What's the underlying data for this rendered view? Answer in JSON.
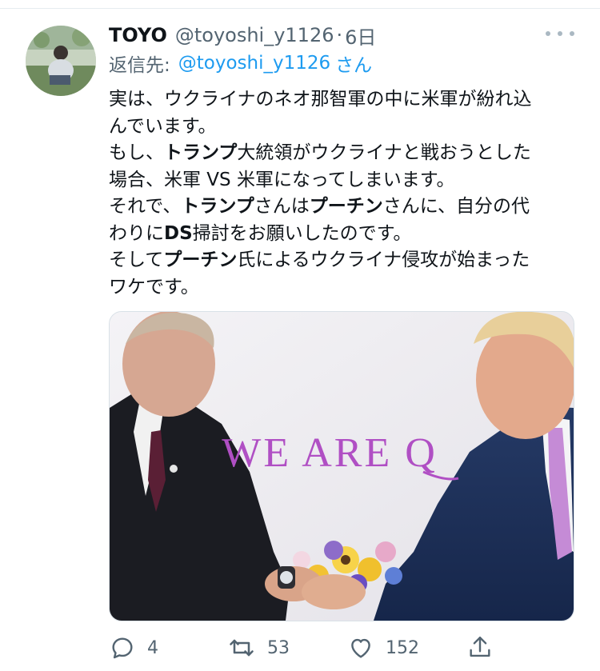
{
  "tweet": {
    "display_name": "TOYO",
    "handle": "@toyoshi_y1126",
    "separator": "·",
    "time": "6日",
    "reply_prefix": "返信先:",
    "reply_handle": "@toyoshi_y1126",
    "reply_suffix": "さん",
    "body_lines": [
      [
        {
          "t": "実は、ウクライナのネオ那智軍の中に米軍が紛れ込"
        }
      ],
      [
        {
          "t": "んでいます。"
        }
      ],
      [
        {
          "t": "もし、"
        },
        {
          "t": "トランプ",
          "b": true
        },
        {
          "t": "大統領がウクライナと戦おうとした"
        }
      ],
      [
        {
          "t": "場合、米軍 VS 米軍になってしまいます。"
        }
      ],
      [
        {
          "t": "それで、"
        },
        {
          "t": "トランプ",
          "b": true
        },
        {
          "t": "さんは"
        },
        {
          "t": "プーチン",
          "b": true
        },
        {
          "t": "さんに、自分の代"
        }
      ],
      [
        {
          "t": "わりに"
        },
        {
          "t": "DS",
          "b": true
        },
        {
          "t": "掃討をお願いしたのです。"
        }
      ],
      [
        {
          "t": "そして"
        },
        {
          "t": "プーチン",
          "b": true
        },
        {
          "t": "氏によるウクライナ侵攻が始まった"
        }
      ],
      [
        {
          "t": "ワケです。"
        }
      ]
    ],
    "image_caption": "WE ARE Q"
  },
  "actions": {
    "reply_count": "4",
    "retweet_count": "53",
    "like_count": "152"
  },
  "colors": {
    "text_primary": "#0f1419",
    "text_secondary": "#536471",
    "link_blue": "#1d9bf0",
    "caption_purple": "#b04fc4"
  },
  "icons": [
    "more-dots-icon",
    "reply-icon",
    "retweet-icon",
    "like-icon",
    "share-icon"
  ]
}
